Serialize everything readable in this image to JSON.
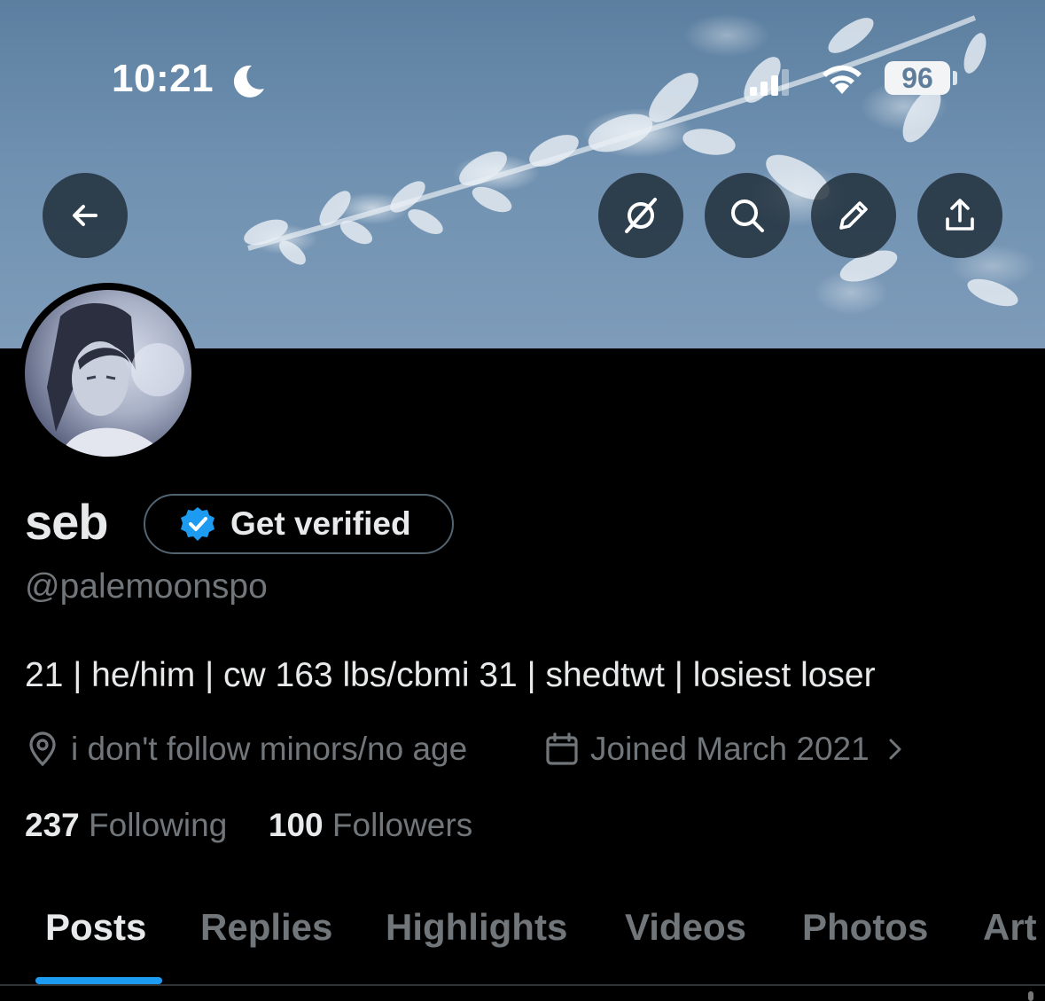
{
  "status_bar": {
    "time": "10:21",
    "battery": "96"
  },
  "header": {
    "back_icon": "arrow-left-icon",
    "actions": [
      "grok-icon",
      "search-icon",
      "pencil-icon",
      "share-icon"
    ]
  },
  "profile": {
    "display_name": "seb",
    "get_verified_label": "Get verified",
    "handle": "@palemoonspo",
    "bio": "21 | he/him | cw 163 lbs/cbmi 31 | shedtwt | losiest loser",
    "location": "i don't follow minors/no age",
    "joined": "Joined March 2021",
    "following_count": "237",
    "following_label": "Following",
    "followers_count": "100",
    "followers_label": "Followers"
  },
  "tabs": [
    {
      "label": "Posts",
      "active": true
    },
    {
      "label": "Replies",
      "active": false
    },
    {
      "label": "Highlights",
      "active": false
    },
    {
      "label": "Videos",
      "active": false
    },
    {
      "label": "Photos",
      "active": false
    },
    {
      "label": "Art",
      "active": false
    }
  ],
  "colors": {
    "accent": "#1d9bf0",
    "muted": "#71767b",
    "text": "#e7e9ea",
    "background": "#000000"
  }
}
